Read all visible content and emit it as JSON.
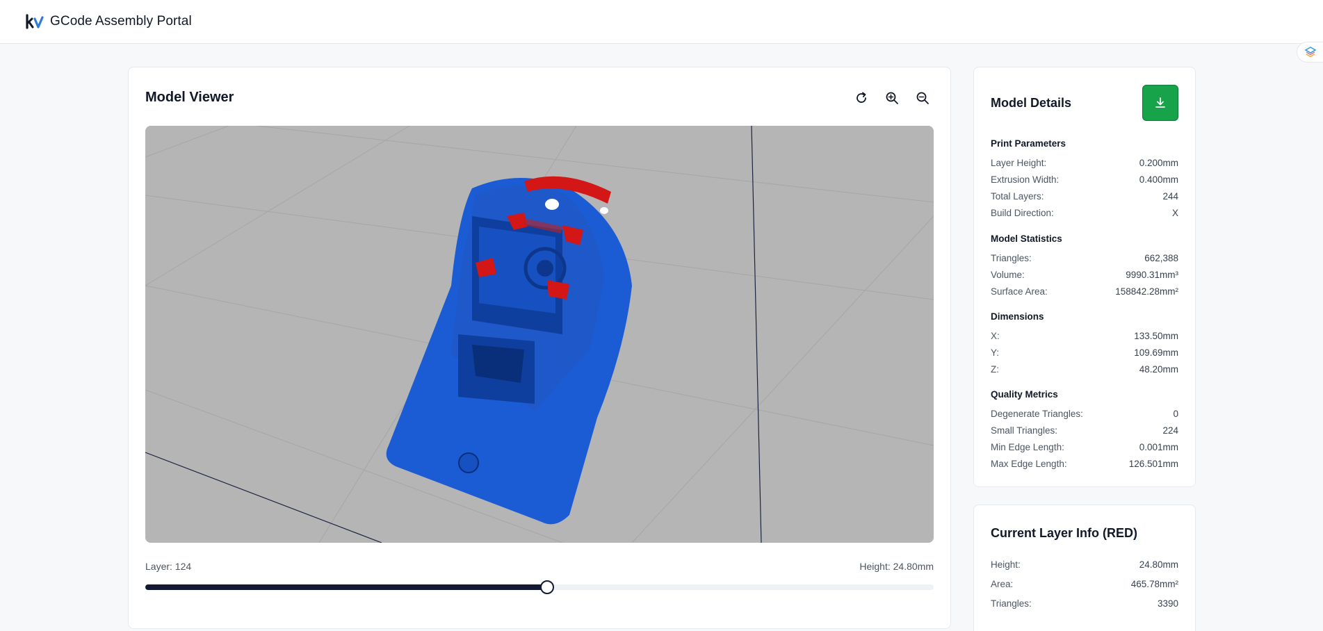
{
  "header": {
    "title": "GCode Assembly Portal",
    "logo_text": "kv"
  },
  "viewer": {
    "title": "Model Viewer",
    "tools": [
      "reset-view-icon",
      "zoom-in-icon",
      "zoom-out-icon"
    ],
    "layer_label": "Layer: 124",
    "height_label": "Height: 24.80mm",
    "slider_fraction": 0.51,
    "colors": {
      "canvas_bg": "#b5b5b5",
      "model_blue": "#1b5bd4",
      "current_layer_red": "#d31616"
    }
  },
  "details": {
    "title": "Model Details",
    "download_icon": "download-icon",
    "print_parameters": {
      "heading": "Print Parameters",
      "rows": [
        {
          "label": "Layer Height:",
          "value": "0.200mm"
        },
        {
          "label": "Extrusion Width:",
          "value": "0.400mm"
        },
        {
          "label": "Total Layers:",
          "value": "244"
        },
        {
          "label": "Build Direction:",
          "value": "X"
        }
      ]
    },
    "model_statistics": {
      "heading": "Model Statistics",
      "rows": [
        {
          "label": "Triangles:",
          "value": "662,388"
        },
        {
          "label": "Volume:",
          "value": "9990.31mm³"
        },
        {
          "label": "Surface Area:",
          "value": "158842.28mm²"
        }
      ]
    },
    "dimensions": {
      "heading": "Dimensions",
      "rows": [
        {
          "label": "X:",
          "value": "133.50mm"
        },
        {
          "label": "Y:",
          "value": "109.69mm"
        },
        {
          "label": "Z:",
          "value": "48.20mm"
        }
      ]
    },
    "quality_metrics": {
      "heading": "Quality Metrics",
      "rows": [
        {
          "label": "Degenerate Triangles:",
          "value": "0"
        },
        {
          "label": "Small Triangles:",
          "value": "224"
        },
        {
          "label": "Min Edge Length:",
          "value": "0.001mm"
        },
        {
          "label": "Max Edge Length:",
          "value": "126.501mm"
        }
      ]
    }
  },
  "current_layer": {
    "title": "Current Layer Info (RED)",
    "rows": [
      {
        "label": "Height:",
        "value": "24.80mm"
      },
      {
        "label": "Area:",
        "value": "465.78mm²"
      },
      {
        "label": "Triangles:",
        "value": "3390"
      }
    ]
  }
}
